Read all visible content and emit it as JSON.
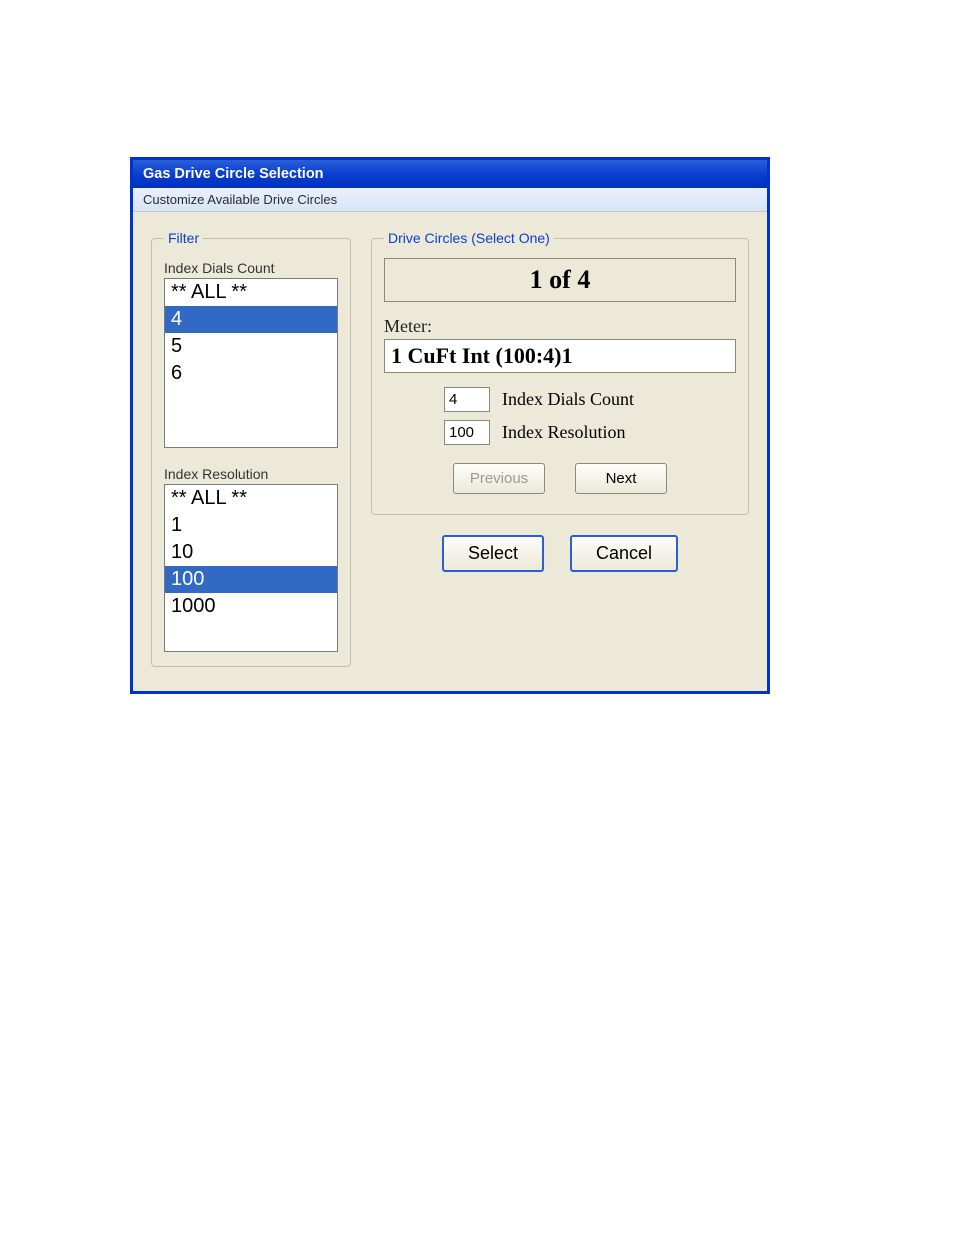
{
  "window": {
    "title": "Gas Drive Circle Selection"
  },
  "menu": {
    "customize": "Customize Available Drive Circles"
  },
  "filter": {
    "legend": "Filter",
    "dials_label": "Index Dials Count",
    "dials_options": [
      "** ALL **",
      "4",
      "5",
      "6"
    ],
    "dials_selected_index": 1,
    "res_label": "Index Resolution",
    "res_options": [
      "** ALL **",
      "1",
      "10",
      "100",
      "1000"
    ],
    "res_selected_index": 3
  },
  "drive": {
    "legend": "Drive Circles (Select One)",
    "counter": "1 of 4",
    "meter_label": "Meter:",
    "meter_value": "1 CuFt Int (100:4)1",
    "dials_value": "4",
    "dials_label": "Index Dials Count",
    "res_value": "100",
    "res_label": "Index Resolution",
    "previous": "Previous",
    "next": "Next"
  },
  "actions": {
    "select": "Select",
    "cancel": "Cancel"
  }
}
